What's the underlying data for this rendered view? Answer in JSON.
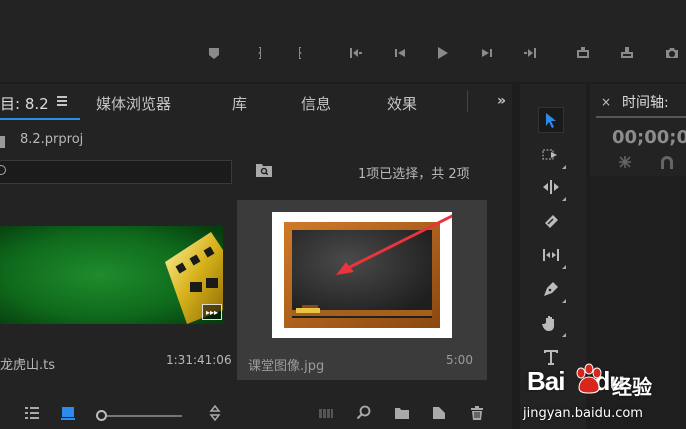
{
  "project_panel": {
    "tabs": [
      {
        "label": "目: 8.2"
      },
      {
        "label": "媒体浏览器"
      },
      {
        "label": "库"
      },
      {
        "label": "信息"
      },
      {
        "label": "效果"
      }
    ],
    "overflow_label": "»",
    "project_file": "8.2.prproj",
    "selection_status": "1项已选择，共 2项",
    "clips": [
      {
        "name": "龙虎山.ts",
        "duration": "1:31:41:06",
        "badge": "▸▸▸"
      },
      {
        "name": "课堂图像.jpg",
        "duration": "5:00",
        "selected": true
      }
    ]
  },
  "timeline_panel": {
    "close_label": "×",
    "title": "时间轴:",
    "timecode": "00;00;0"
  },
  "watermark": {
    "logo_text": "Bai",
    "logo_suffix": "du",
    "brand": "经验",
    "url": "jingyan.baidu.com"
  },
  "colors": {
    "accent": "#2d8ceb",
    "panel_bg": "#232323",
    "selected_tile": "#3b3b3b"
  },
  "icons": {
    "toolbar": [
      "marker-icon",
      "mark-in-icon",
      "mark-out-icon",
      "go-to-in-icon",
      "step-back-icon",
      "play-icon",
      "step-forward-icon",
      "go-to-out-icon",
      "insert-icon",
      "overwrite-icon",
      "export-frame-icon"
    ],
    "tools": [
      "selection-tool-icon",
      "track-select-tool-icon",
      "ripple-edit-tool-icon",
      "razor-tool-icon",
      "slip-tool-icon",
      "pen-tool-icon",
      "hand-tool-icon",
      "type-tool-icon"
    ]
  }
}
